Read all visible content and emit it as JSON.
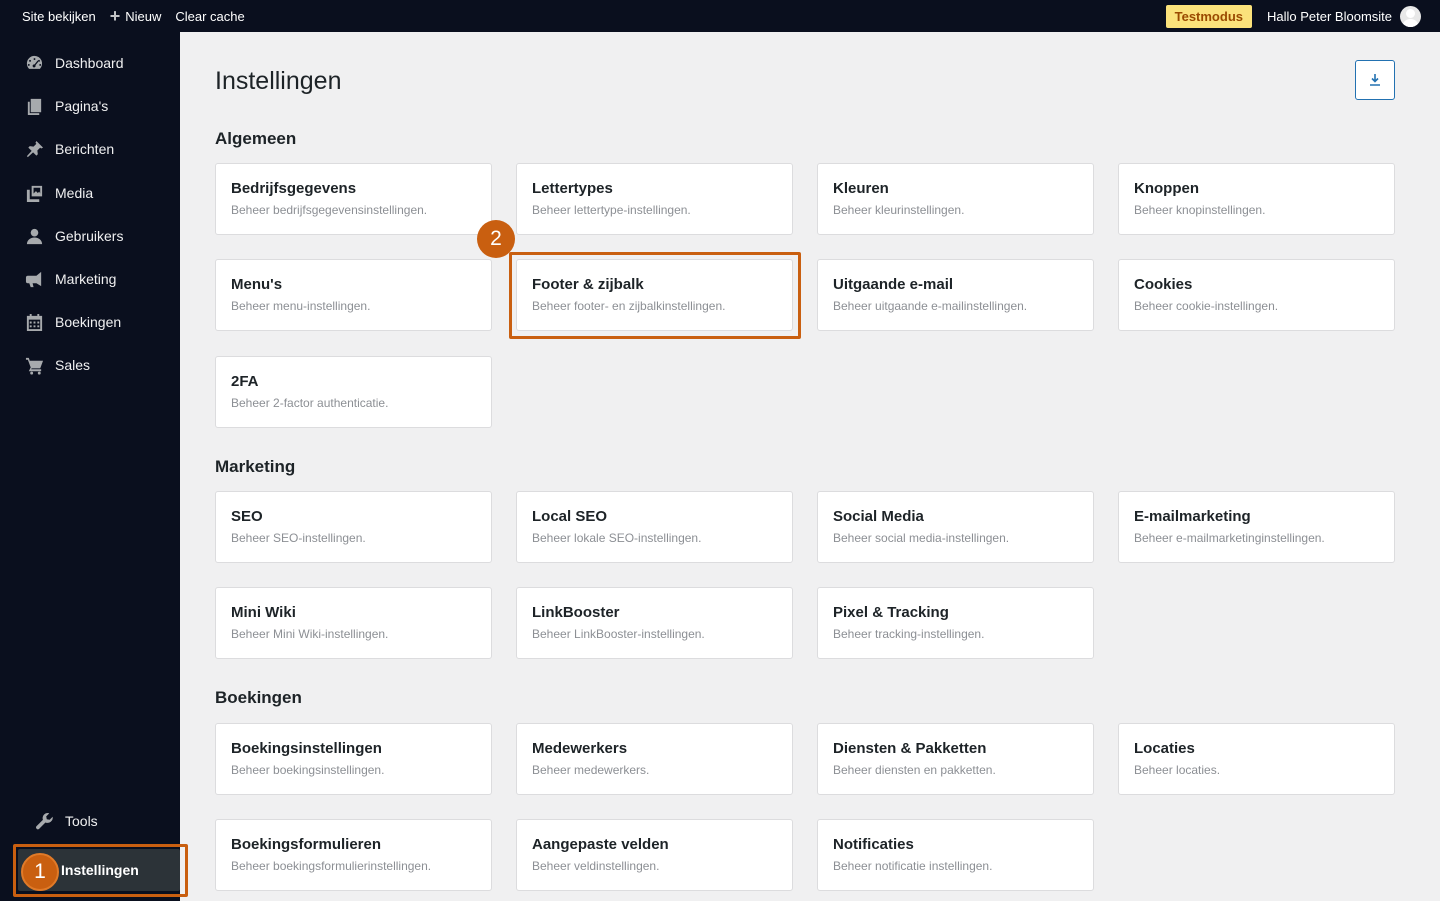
{
  "topbar": {
    "view_site": "Site bekijken",
    "new_label": "Nieuw",
    "clear_cache": "Clear cache",
    "test_mode": "Testmodus",
    "greeting": "Hallo Peter Bloomsite"
  },
  "sidebar": {
    "items": [
      {
        "label": "Dashboard",
        "icon": "dashboard-icon"
      },
      {
        "label": "Pagina's",
        "icon": "pages-icon"
      },
      {
        "label": "Berichten",
        "icon": "pin-icon"
      },
      {
        "label": "Media",
        "icon": "media-icon"
      },
      {
        "label": "Gebruikers",
        "icon": "user-icon"
      },
      {
        "label": "Marketing",
        "icon": "megaphone-icon"
      },
      {
        "label": "Boekingen",
        "icon": "calendar-icon"
      },
      {
        "label": "Sales",
        "icon": "cart-icon"
      }
    ],
    "tools": "Tools",
    "settings": "Instellingen"
  },
  "page": {
    "title": "Instellingen"
  },
  "sections": [
    {
      "title": "Algemeen",
      "cards": [
        {
          "title": "Bedrijfsgegevens",
          "desc": "Beheer bedrijfsgegevensinstellingen."
        },
        {
          "title": "Lettertypes",
          "desc": "Beheer lettertype-instellingen."
        },
        {
          "title": "Kleuren",
          "desc": "Beheer kleurinstellingen."
        },
        {
          "title": "Knoppen",
          "desc": "Beheer knopinstellingen."
        },
        {
          "title": "Menu's",
          "desc": "Beheer menu-instellingen."
        },
        {
          "title": "Footer & zijbalk",
          "desc": "Beheer footer- en zijbalkinstellingen."
        },
        {
          "title": "Uitgaande e-mail",
          "desc": "Beheer uitgaande e-mailinstellingen."
        },
        {
          "title": "Cookies",
          "desc": "Beheer cookie-instellingen."
        },
        {
          "title": "2FA",
          "desc": "Beheer 2-factor authenticatie."
        }
      ]
    },
    {
      "title": "Marketing",
      "cards": [
        {
          "title": "SEO",
          "desc": "Beheer SEO-instellingen."
        },
        {
          "title": "Local SEO",
          "desc": "Beheer lokale SEO-instellingen."
        },
        {
          "title": "Social Media",
          "desc": "Beheer social media-instellingen."
        },
        {
          "title": "E-mailmarketing",
          "desc": "Beheer e-mailmarketinginstellingen."
        },
        {
          "title": "Mini Wiki",
          "desc": "Beheer Mini Wiki-instellingen."
        },
        {
          "title": "LinkBooster",
          "desc": "Beheer LinkBooster-instellingen."
        },
        {
          "title": "Pixel & Tracking",
          "desc": "Beheer tracking-instellingen."
        }
      ]
    },
    {
      "title": "Boekingen",
      "cards": [
        {
          "title": "Boekingsinstellingen",
          "desc": "Beheer boekingsinstellingen."
        },
        {
          "title": "Medewerkers",
          "desc": "Beheer medewerkers."
        },
        {
          "title": "Diensten & Pakketten",
          "desc": "Beheer diensten en pakketten."
        },
        {
          "title": "Locaties",
          "desc": "Beheer locaties."
        },
        {
          "title": "Boekingsformulieren",
          "desc": "Beheer boekingsformulierinstellingen."
        },
        {
          "title": "Aangepaste velden",
          "desc": "Beheer veldinstellingen."
        },
        {
          "title": "Notificaties",
          "desc": "Beheer notificatie instellingen."
        }
      ]
    }
  ],
  "annotations": {
    "marker_1": "1",
    "marker_2": "2",
    "color": "#c95f10"
  }
}
